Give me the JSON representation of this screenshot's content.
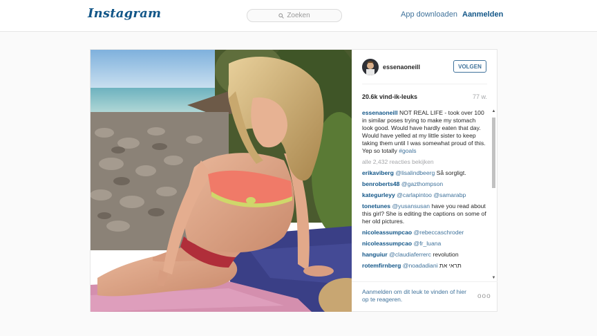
{
  "header": {
    "logo": "Instagram",
    "search_placeholder": "Zoeken",
    "download_label": "App downloaden",
    "login_label": "Aanmelden"
  },
  "post": {
    "username": "essenaoneill",
    "follow_label": "VOLGEN",
    "likes": "20.6k vind-ik-leuks",
    "age": "77 w.",
    "caption": {
      "user": "essenaoneill",
      "text": "NOT REAL LIFE - took over 100 in similar poses trying to make my stomach look good. Would have hardly eaten that day. Would have yelled at my little sister to keep taking them until I was somewhat proud of this. Yep so totally",
      "hashtag": "#goals"
    },
    "load_more": "alle 2,432 reacties bekijken",
    "comments": [
      {
        "user": "erikaviberg",
        "mention": "@lisalindbeerg",
        "text": "Så sorgligt."
      },
      {
        "user": "benroberts48",
        "mention": "@gazthompson",
        "text": ""
      },
      {
        "user": "kategurleyy",
        "mention": "@carlapintoo @samarabp",
        "text": ""
      },
      {
        "user": "tonetunes",
        "mention": "@yusansusan",
        "text": "have you read about this girl? She is editing the captions on some of her old pictures."
      },
      {
        "user": "nicoleassumpcao",
        "mention": "@rebeccaschroder",
        "text": ""
      },
      {
        "user": "nicoleassumpcao",
        "mention": "@fr_luana",
        "text": ""
      },
      {
        "user": "hanguiur",
        "mention": "@claudiaferrerc",
        "text": "revolution"
      },
      {
        "user": "rotemfirnberg",
        "mention": "@noadadiani",
        "text": "תראי את"
      }
    ],
    "login_prompt": "Aanmelden om dit leuk te vinden of hier op te reageren.",
    "more_label": "ooo"
  },
  "colors": {
    "link": "#3f729b",
    "brand": "#125688",
    "muted": "#a5a7aa"
  }
}
